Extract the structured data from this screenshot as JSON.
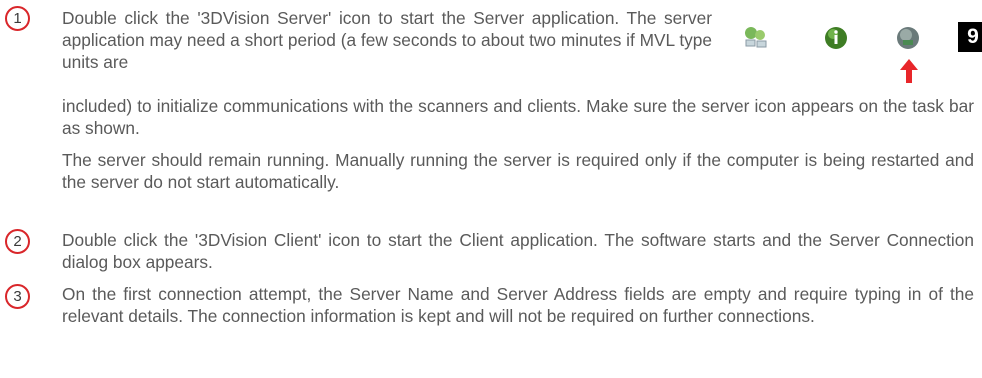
{
  "steps": [
    {
      "number": "1",
      "text_floated": "Double click the '3DVision Server' icon to start the Server application. The server application may need a short period (a few seconds to about two minutes if MVL type units are",
      "text_continued": "included) to initialize communications with the scanners and clients. Make sure the server icon appears on the task bar as shown.",
      "note": "The server should remain running. Manually running the server is required only if the computer is being restarted and the server do not start automatically."
    },
    {
      "number": "2",
      "text": "Double click the '3DVision Client' icon to start the Client application. The software starts and the Server Connection dialog box appears."
    },
    {
      "number": "3",
      "text": "On the first connection attempt, the Server Name and Server Address fields are empty and require typing in of the relevant details. The connection information is kept and will not be required on further connections."
    }
  ],
  "taskbar": {
    "icons": [
      "network-icon",
      "info-icon",
      "server-icon",
      "clock-icon"
    ],
    "clock_text": "9",
    "arrow_color": "#e8262a"
  },
  "colors": {
    "accent": "#d9262a",
    "text": "#5a5a5a"
  }
}
